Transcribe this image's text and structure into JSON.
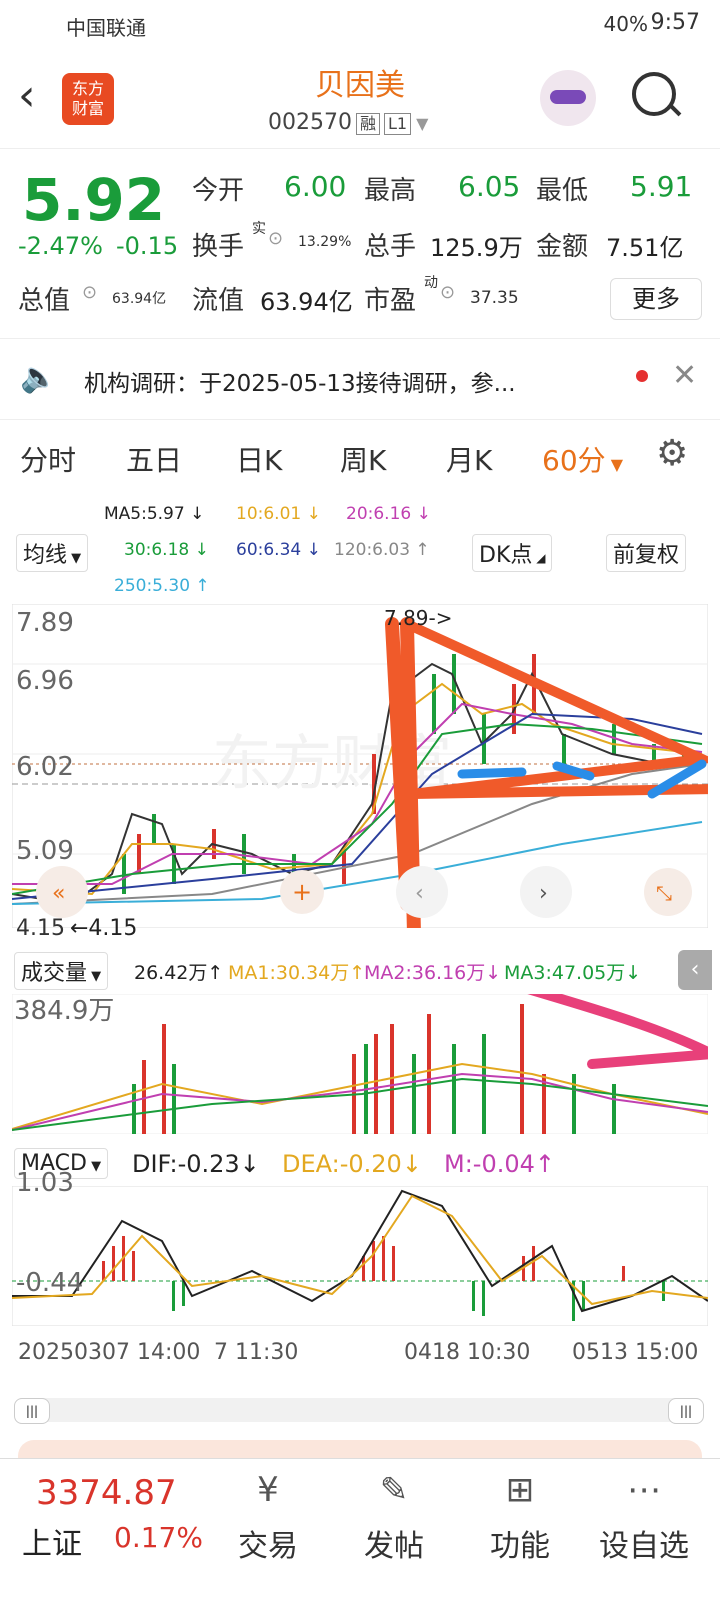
{
  "status": {
    "carrier": "中国联通",
    "battery": "40%",
    "time": "9:57"
  },
  "header": {
    "logo_line1": "东方",
    "logo_line2": "财富",
    "name": "贝因美",
    "code": "002570",
    "tag1": "融",
    "tag2": "L1"
  },
  "quote": {
    "price": "5.92",
    "change_pct": "-2.47%",
    "change": "-0.15",
    "open_label": "今开",
    "open": "6.00",
    "high_label": "最高",
    "high": "6.05",
    "low_label": "最低",
    "low": "5.91",
    "turnover_label": "换手",
    "turnover_sup": "实",
    "turnover": "13.29%",
    "vol_label": "总手",
    "vol": "125.9万",
    "amt_label": "金额",
    "amt": "7.51亿",
    "mcap_label": "总值",
    "mcap": "63.94亿",
    "float_label": "流值",
    "float": "63.94亿",
    "pe_label": "市盈",
    "pe_sup": "动",
    "pe": "37.35",
    "more": "更多"
  },
  "news": {
    "text": "机构调研：于2025-05-13接待调研，参..."
  },
  "tabs": [
    "分时",
    "五日",
    "日K",
    "周K",
    "月K",
    "60分"
  ],
  "ma_row": {
    "ma5": "MA5:5.97 ↓",
    "ma10": "10:6.01 ↓",
    "ma20": "20:6.16 ↓",
    "ma30": "30:6.18 ↓",
    "ma60": "60:6.34 ↓",
    "ma120": "120:6.03 ↑",
    "ma250": "250:5.30 ↑",
    "avg_btn": "均线",
    "dk_btn": "DK点",
    "fq_btn": "前复权"
  },
  "kline": {
    "y1": "7.89",
    "y2": "6.96",
    "y3": "6.02",
    "y4": "5.09",
    "y5": "4.15",
    "high_label": "7.89->",
    "low_label": "←4.15"
  },
  "volume": {
    "btn": "成交量",
    "v": "26.42万↑",
    "ma1": "MA1:30.34万↑",
    "ma2": "MA2:36.16万↓",
    "ma3": "MA3:47.05万↓",
    "ymax": "384.9万"
  },
  "macd": {
    "btn": "MACD",
    "dif": "DIF:-0.23↓",
    "dea": "DEA:-0.20↓",
    "m": "M:-0.04↑",
    "ymax": "1.03",
    "ymin": "-0.44"
  },
  "dates": {
    "d1": "20250307 14:00",
    "d2": "7 11:30",
    "d3": "0418 10:30",
    "d4": "0513 15:00"
  },
  "bottom": {
    "index_val": "3374.87",
    "index_name": "上证",
    "index_pct": "0.17%",
    "trade": "交易",
    "post": "发帖",
    "func": "功能",
    "watch": "设自选"
  },
  "colors": {
    "up": "#d9342b",
    "down": "#1a9c3a",
    "accent": "#e8711a"
  }
}
